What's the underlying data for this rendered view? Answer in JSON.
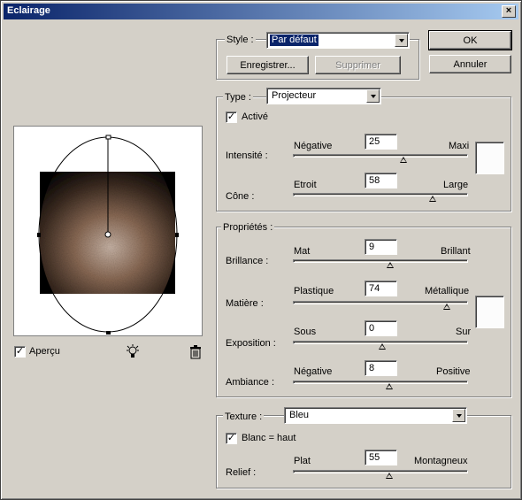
{
  "window": {
    "title": "Eclairage",
    "close_label": "×"
  },
  "buttons": {
    "ok": "OK",
    "cancel": "Annuler"
  },
  "style_group": {
    "label": "Style :",
    "value": "Par défaut",
    "save_button": "Enregistrer...",
    "delete_button": "Supprimer"
  },
  "type_group": {
    "label": "Type :",
    "value": "Projecteur",
    "active_label": "Activé",
    "active_checked": true,
    "intensity": {
      "label": "Intensité :",
      "min": "Négative",
      "max": "Maxi",
      "value": "25"
    },
    "cone": {
      "label": "Cône :",
      "min": "Etroit",
      "max": "Large",
      "value": "58"
    },
    "light_color": "#fcfcfc"
  },
  "properties_group": {
    "label": "Propriétés :",
    "gloss": {
      "label": "Brillance :",
      "min": "Mat",
      "max": "Brillant",
      "value": "9"
    },
    "material": {
      "label": "Matière :",
      "min": "Plastique",
      "max": "Métallique",
      "value": "74"
    },
    "exposure": {
      "label": "Exposition :",
      "min": "Sous",
      "max": "Sur",
      "value": "0"
    },
    "ambience": {
      "label": "Ambiance :",
      "min": "Négative",
      "max": "Positive",
      "value": "8"
    },
    "ambient_color": "#fcfcfc"
  },
  "texture_group": {
    "label": "Texture :",
    "value": "Bleu",
    "white_high_label": "Blanc = haut",
    "white_high_checked": true,
    "relief": {
      "label": "Relief :",
      "min": "Plat",
      "max": "Montagneux",
      "value": "55"
    }
  },
  "preview": {
    "show_label": "Aperçu",
    "show_checked": true,
    "light_bulb_icon": "light-bulb-icon",
    "trash_icon": "trash-icon"
  },
  "check_glyph": "✓"
}
